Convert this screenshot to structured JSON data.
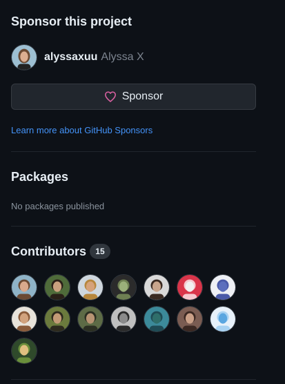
{
  "sponsor": {
    "heading": "Sponsor this project",
    "maintainer": {
      "login": "alyssaxuu",
      "name": "Alyssa X"
    },
    "button_label": "Sponsor",
    "learn_more": "Learn more about GitHub Sponsors"
  },
  "packages": {
    "heading": "Packages",
    "empty_text": "No packages published"
  },
  "contributors": {
    "heading": "Contributors",
    "count": "15",
    "avatars": [
      {
        "bg": "#8fb3c7",
        "fg": "#d9a98c",
        "hair": "#6b4a33"
      },
      {
        "bg": "#4f6b3a",
        "fg": "#c9a07e",
        "hair": "#2a2018"
      },
      {
        "bg": "#cfd7de",
        "fg": "#d6a27a",
        "hair": "#b7873d"
      },
      {
        "bg": "#2b2b2b",
        "fg": "#9bb07a",
        "hair": "#6e7f52"
      },
      {
        "bg": "#d9d9d9",
        "fg": "#c9a58c",
        "hair": "#3a2a22"
      },
      {
        "bg": "#d9354a",
        "fg": "#f1f1f1",
        "hair": "#f6c9cf"
      },
      {
        "bg": "#eef0f5",
        "fg": "#5c6fbd",
        "hair": "#4a5aa8"
      },
      {
        "bg": "#e8e3da",
        "fg": "#d1a27d",
        "hair": "#8a5b3a"
      },
      {
        "bg": "#6b7a3d",
        "fg": "#c29a76",
        "hair": "#2d2a1e"
      },
      {
        "bg": "#5d6b46",
        "fg": "#b89473",
        "hair": "#2b2f22"
      },
      {
        "bg": "#bfbfbf",
        "fg": "#8a8a8a",
        "hair": "#2a2a2a"
      },
      {
        "bg": "#3c8a9a",
        "fg": "#2f6e6a",
        "hair": "#1f4b55"
      },
      {
        "bg": "#7a5c52",
        "fg": "#caa088",
        "hair": "#3b2822"
      },
      {
        "bg": "#e7f1fa",
        "fg": "#5aa6e0",
        "hair": "#a8d2f2"
      },
      {
        "bg": "#2f4a2b",
        "fg": "#e0c080",
        "hair": "#6a8f3b"
      }
    ]
  }
}
